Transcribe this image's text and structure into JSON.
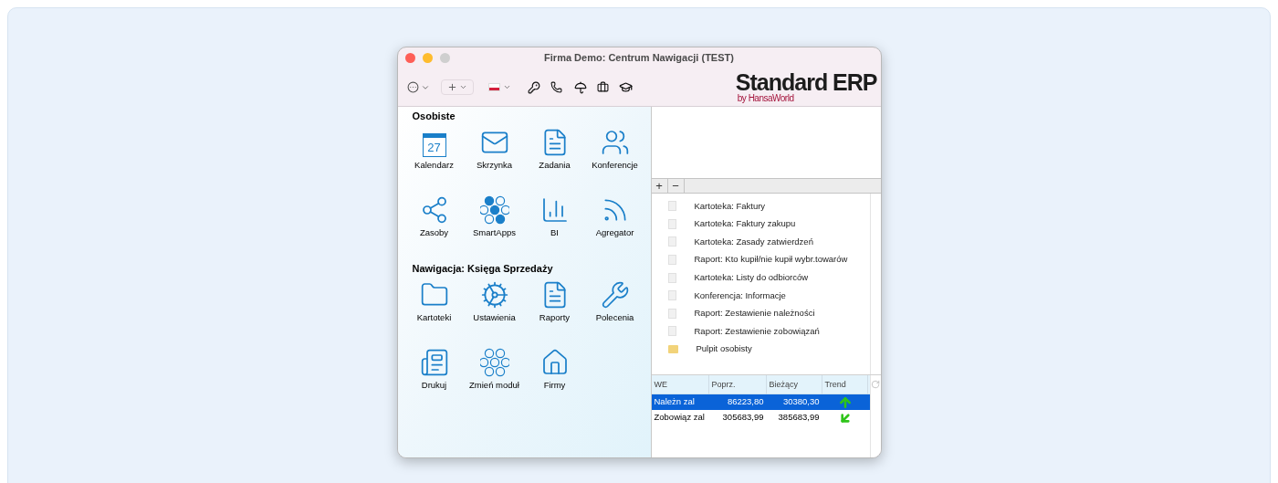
{
  "window": {
    "title": "Firma Demo: Centrum Nawigacji (TEST)"
  },
  "logo": {
    "name": "Standard ERP",
    "byline": "by HansaWorld"
  },
  "sections": [
    {
      "title": "Osobiste",
      "items": [
        {
          "label": "Kalendarz",
          "kind": "calendar",
          "day": "27"
        },
        {
          "label": "Skrzynka",
          "kind": "mail"
        },
        {
          "label": "Zadania",
          "kind": "tasks"
        },
        {
          "label": "Konferencje",
          "kind": "people"
        },
        {
          "label": "Zasoby",
          "kind": "network"
        },
        {
          "label": "SmartApps",
          "kind": "hexagons"
        },
        {
          "label": "BI",
          "kind": "chart"
        },
        {
          "label": "Agregator",
          "kind": "feed"
        }
      ]
    },
    {
      "title": "Nawigacja: Księga Sprzedaży",
      "items": [
        {
          "label": "Kartoteki",
          "kind": "folder"
        },
        {
          "label": "Ustawienia",
          "kind": "gears"
        },
        {
          "label": "Raporty",
          "kind": "report"
        },
        {
          "label": "Polecenia",
          "kind": "tools"
        },
        {
          "label": "Drukuj",
          "kind": "print"
        },
        {
          "label": "Zmień moduł",
          "kind": "hexagons_outline"
        },
        {
          "label": "Firmy",
          "kind": "home"
        }
      ]
    }
  ],
  "list_toolbar": [
    "+",
    "−"
  ],
  "shortcuts": [
    {
      "label": "Kartoteka: Faktury",
      "kind": "document"
    },
    {
      "label": "Kartoteka: Faktury zakupu",
      "kind": "document"
    },
    {
      "label": "Kartoteka: Zasady zatwierdzeń",
      "kind": "document"
    },
    {
      "label": "Raport: Kto kupił/nie kupił wybr.towarów",
      "kind": "document"
    },
    {
      "label": "Kartoteka: Listy do odbiorców",
      "kind": "document"
    },
    {
      "label": "Konferencja: Informacje",
      "kind": "document"
    },
    {
      "label": "Raport: Zestawienie należności",
      "kind": "document"
    },
    {
      "label": "Raport: Zestawienie zobowiązań",
      "kind": "document"
    },
    {
      "label": "Pulpit osobisty",
      "kind": "folder"
    }
  ],
  "kpi_table": {
    "columns": [
      "WE",
      "Poprz.",
      "Bieżący",
      "Trend"
    ],
    "rows": [
      {
        "name": "Należn zal",
        "previous": "86223,80",
        "current": "30380,30",
        "kind": "up",
        "selected": true
      },
      {
        "name": "Zobowiąz zal",
        "previous": "305683,99",
        "current": "385683,99",
        "kind": "down_left",
        "selected": false
      }
    ]
  }
}
